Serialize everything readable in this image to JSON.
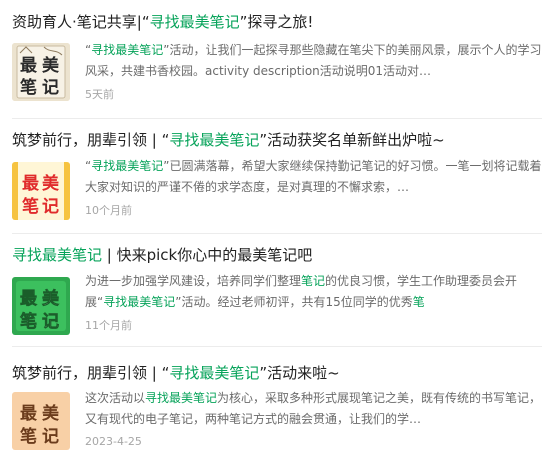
{
  "articles": [
    {
      "title_pre": "资助育人·笔记共享|“",
      "title_hl": "寻找最美笔记",
      "title_post": "”探寻之旅!",
      "snippet_hl": "寻找最美笔记",
      "snippet_rest": "”活动，让我们一起探寻那些隐藏在笔尖下的美丽风景，展示个人的学习风采，共建书香校园。activity description活动说明01活动对…",
      "date": "5天前",
      "thumb_text": "最美笔记"
    },
    {
      "title_pre": "筑梦前行，朋辈引领 | “",
      "title_hl": "寻找最美笔记",
      "title_post": "”活动获奖名单新鲜出炉啦~",
      "snippet_hl": "寻找最美笔记",
      "snippet_rest": "”已圆满落幕，希望大家继续保持勤记笔记的好习惯。一笔一划将记载着大家对知识的严谨不倦的求学态度，是对真理的不懈求索，…",
      "date": "10个月前",
      "thumb_text": "最美笔记"
    },
    {
      "title_hl": "寻找最美笔记",
      "title_post": " | 快来pick你心中的最美笔记吧",
      "snippet_a": "为进一步加强学风建设，培养同学们整理",
      "snippet_hl1": "笔记",
      "snippet_b": "的优良习惯，学生工作助理委员会开展“",
      "snippet_hl2": "寻找最美笔记",
      "snippet_c": "”活动。经过老师初评，共有15位同学的优秀",
      "snippet_hl3": "笔",
      "date": "11个月前",
      "thumb_text": "最美笔记"
    },
    {
      "title_pre": "筑梦前行，朋辈引领 | “",
      "title_hl": "寻找最美笔记",
      "title_post": "”活动来啦~",
      "snippet_a": "这次活动以",
      "snippet_hl1": "寻找最美笔记",
      "snippet_b": "为核心，采取多种形式展现笔记之美，既有传统的书写笔记，又有现代的电子笔记，两种笔记方式的融会贯通，让我们的学…",
      "date": "2023-4-25",
      "thumb_text": "最美笔记"
    }
  ],
  "colors": {
    "highlight": "#07a35a",
    "text": "#222222",
    "snippet": "#6b6b6b",
    "date": "#a6a6a6"
  }
}
